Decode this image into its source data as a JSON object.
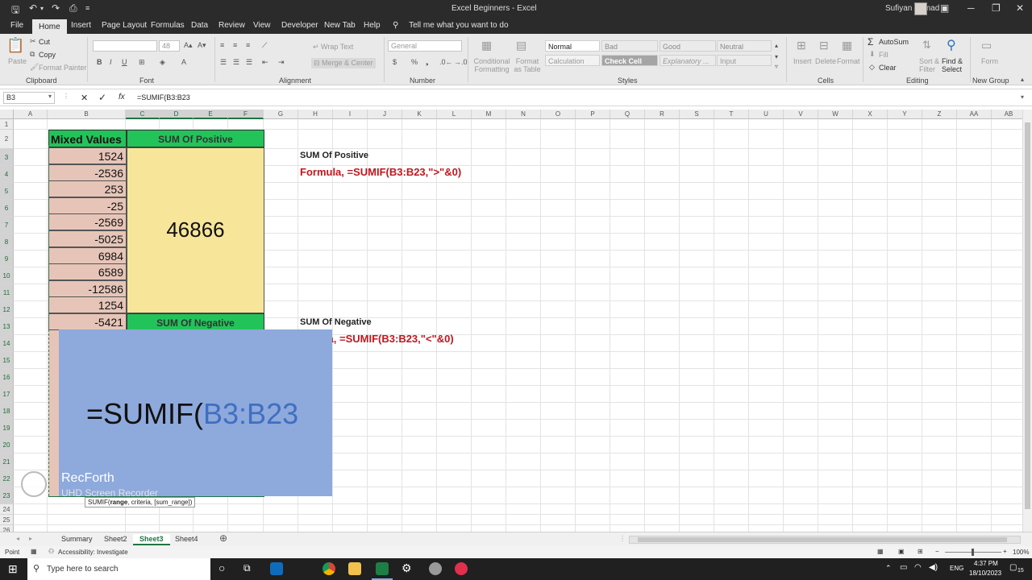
{
  "window": {
    "title": "Excel Beginners  -  Excel",
    "user": "Sufiyan Ahmad"
  },
  "tabs": [
    "File",
    "Home",
    "Insert",
    "Page Layout",
    "Formulas",
    "Data",
    "Review",
    "View",
    "Developer",
    "New Tab",
    "Help"
  ],
  "tell_me": "Tell me what you want to do",
  "ribbon": {
    "clipboard": {
      "label": "Clipboard",
      "paste": "Paste",
      "cut": "Cut",
      "copy": "Copy",
      "format_painter": "Format Painter"
    },
    "font": {
      "label": "Font",
      "size": "48",
      "bold": "B",
      "italic": "I",
      "underline": "U"
    },
    "alignment": {
      "label": "Alignment",
      "wrap": "Wrap Text",
      "merge": "Merge & Center"
    },
    "number": {
      "label": "Number",
      "format": "General",
      "currency": "$",
      "percent": "%"
    },
    "styles": {
      "label": "Styles",
      "conditional": "Conditional Formatting",
      "format_as_table": "Format as Table",
      "normal": "Normal",
      "bad": "Bad",
      "good": "Good",
      "neutral": "Neutral",
      "calculation": "Calculation",
      "check_cell": "Check Cell",
      "explanatory": "Explanatory ...",
      "input": "Input"
    },
    "cells": {
      "label": "Cells",
      "insert": "Insert",
      "delete": "Delete",
      "format": "Format"
    },
    "editing": {
      "label": "Editing",
      "autosum": "AutoSum",
      "fill": "Fill",
      "clear": "Clear",
      "sort": "Sort & Filter",
      "find": "Find & Select"
    },
    "new_group": {
      "label": "New Group",
      "form": "Form"
    }
  },
  "formula_bar": {
    "name_box": "B3",
    "fx": "fx",
    "formula": "=SUMIF(B3:B23"
  },
  "columns": [
    "A",
    "B",
    "C",
    "D",
    "E",
    "F",
    "G",
    "H",
    "I",
    "J",
    "K",
    "L",
    "M",
    "N",
    "O",
    "P",
    "Q",
    "R",
    "S",
    "T",
    "U",
    "V",
    "W",
    "X",
    "Y",
    "Z",
    "AA",
    "AB"
  ],
  "rows": [
    "1",
    "2",
    "3",
    "4",
    "5",
    "6",
    "7",
    "8",
    "9",
    "10",
    "11",
    "12",
    "13",
    "14",
    "15",
    "16",
    "17",
    "18",
    "19",
    "20",
    "21",
    "22",
    "23",
    "24",
    "25",
    "26"
  ],
  "sheet": {
    "header_mixed": "Mixed Values",
    "header_positive": "SUM Of Positive",
    "header_negative": "SUM Of Negative",
    "values": [
      "1524",
      "-2536",
      "253",
      "-25",
      "-2569",
      "-5025",
      "6984",
      "6589",
      "-12586",
      "1254",
      "-5421"
    ],
    "positive_result": "46866",
    "note_positive_title": "SUM Of Positive",
    "note_positive_formula": "Formula, =SUMIF(B3:B23,\">\"&0)",
    "note_negative_title": "SUM Of Negative",
    "note_negative_formula": "ula, =SUMIF(B3:B23,\"<\"&0)"
  },
  "overlay": {
    "prefix": "=SUMIF(",
    "range": "B3:B23"
  },
  "tooltip": {
    "fn": "SUMIF(",
    "arg1": "range",
    "rest": ", criteria, [sum_range])"
  },
  "watermark": {
    "name": "RecForth",
    "sub": "UHD Screen Recorder"
  },
  "sheet_tabs": [
    "Summary",
    "Sheet2",
    "Sheet3",
    "Sheet4"
  ],
  "active_sheet": "Sheet3",
  "status": {
    "mode": "Point",
    "accessibility": "Accessibility: Investigate",
    "zoom": "100%"
  },
  "taskbar": {
    "search": "Type here to search",
    "lang": "ENG",
    "time": "4:37 PM",
    "date": "18/10/2023",
    "notif": "15"
  },
  "colors": {
    "accent": "#217346",
    "header_green": "#22c45a",
    "result_yellow": "#f7e59a",
    "value_fill": "#e6c5b8",
    "overlay": "#8ea9db",
    "formula_red": "#c0171d"
  }
}
